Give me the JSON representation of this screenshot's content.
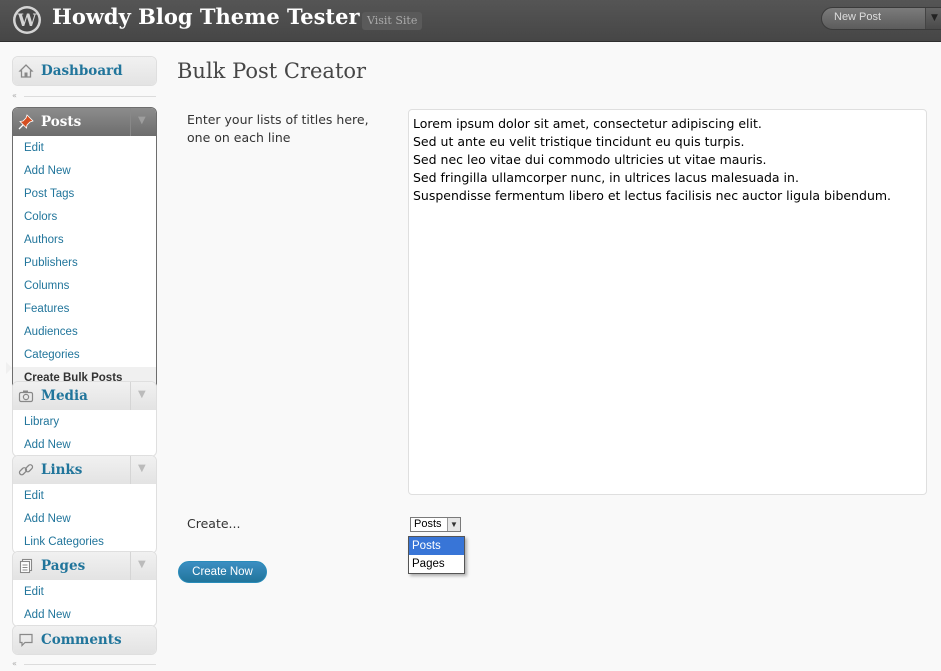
{
  "header": {
    "site_title": "Howdy Blog Theme Tester",
    "visit_site": "Visit Site",
    "favorite_action": "New Post"
  },
  "sidebar": {
    "dashboard": "Dashboard",
    "posts": {
      "label": "Posts",
      "items": [
        "Edit",
        "Add New",
        "Post Tags",
        "Colors",
        "Authors",
        "Publishers",
        "Columns",
        "Features",
        "Audiences",
        "Categories",
        "Create Bulk Posts"
      ],
      "current_index": 10
    },
    "media": {
      "label": "Media",
      "items": [
        "Library",
        "Add New"
      ]
    },
    "links": {
      "label": "Links",
      "items": [
        "Edit",
        "Add New",
        "Link Categories"
      ]
    },
    "pages": {
      "label": "Pages",
      "items": [
        "Edit",
        "Add New"
      ]
    },
    "comments": "Comments"
  },
  "main": {
    "title": "Bulk Post Creator",
    "titles_label": "Enter your lists of titles here, one on each line",
    "titles_value": "Lorem ipsum dolor sit amet, consectetur adipiscing elit.\nSed ut ante eu velit tristique tincidunt eu quis turpis.\nSed nec leo vitae dui commodo ultricies ut vitae mauris.\nSed fringilla ullamcorper nunc, in ultrices lacus malesuada in.\nSuspendisse fermentum libero et lectus facilisis nec auctor ligula bibendum.",
    "create_label": "Create...",
    "type_select": {
      "value": "Posts",
      "options": [
        "Posts",
        "Pages"
      ],
      "highlighted_index": 0
    },
    "submit_label": "Create Now"
  },
  "colors": {
    "link": "#21759b",
    "header_bg": "#464646",
    "button": "#21759b",
    "dropdown_highlight": "#3875d7"
  },
  "icons": {
    "logo": "wordpress-logo-icon",
    "dashboard": "house-icon",
    "posts": "pushpin-icon",
    "media": "camera-icon",
    "links": "chain-link-icon",
    "pages": "documents-icon",
    "comments": "speech-bubble-icon"
  }
}
